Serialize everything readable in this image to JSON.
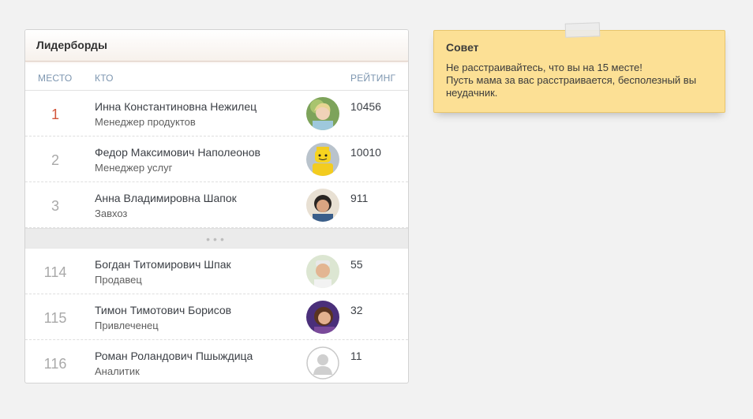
{
  "leaderboard": {
    "title": "Лидерборды",
    "columns": {
      "place": "МЕСТО",
      "who": "КТО",
      "rating": "РЕЙТИНГ"
    },
    "rows_top": [
      {
        "rank": "1",
        "name": "Инна Константиновна Нежилец",
        "role": "Менеджер продуктов",
        "score": "10456",
        "avatar": "photo-woman-icon"
      },
      {
        "rank": "2",
        "name": "Федор Максимович Наполеонов",
        "role": "Менеджер услуг",
        "score": "10010",
        "avatar": "lego-figure-icon"
      },
      {
        "rank": "3",
        "name": "Анна Владимировна Шапок",
        "role": "Завхоз",
        "score": "911",
        "avatar": "photo-man-icon"
      }
    ],
    "gap_dots": "•••",
    "rows_bottom": [
      {
        "rank": "114",
        "name": "Богдан Титомирович Шпак",
        "role": "Продавец",
        "score": "55",
        "avatar": "photo-man-icon"
      },
      {
        "rank": "115",
        "name": "Тимон Тимотович Борисов",
        "role": "Привлеченец",
        "score": "32",
        "avatar": "photo-woman-icon"
      },
      {
        "rank": "116",
        "name": "Роман Роландович Пшыждица",
        "role": "Аналитик",
        "score": "11",
        "avatar": "default-user-icon"
      }
    ]
  },
  "tip": {
    "title": "Совет",
    "line1": "Не расстраивайтесь, что вы на 15 месте!",
    "line2": "Пусть мама за вас расстраивается, бесполезный вы неудачник."
  },
  "colors": {
    "rank_top": "#d2553a",
    "column_header": "#7d96b0",
    "note_bg": "#fce095"
  }
}
